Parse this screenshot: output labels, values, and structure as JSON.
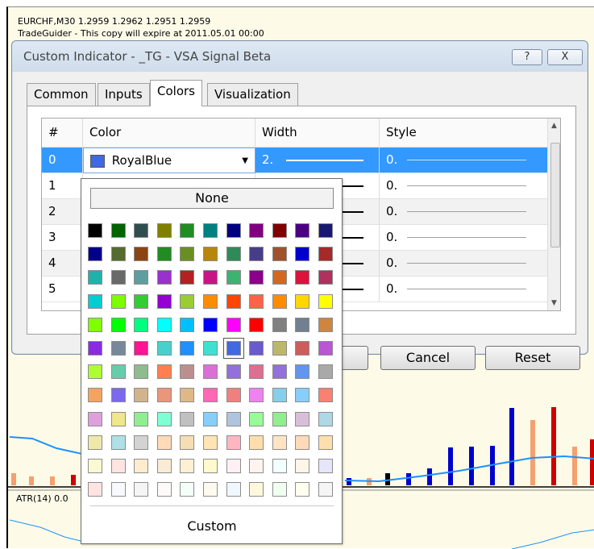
{
  "chart": {
    "header_line1": "EURCHF,M30  1.2959 1.2962 1.2951 1.2959",
    "header_line2": "TradeGuider - This copy will expire at 2011.05.01 00:00",
    "atr_label": "ATR(14) 0.0"
  },
  "dialog": {
    "title": "Custom Indicator - _TG - VSA Signal Beta",
    "help_glyph": "?",
    "close_glyph": "X",
    "tabs": [
      "Common",
      "Inputs",
      "Colors",
      "Visualization"
    ],
    "active_tab": "Colors",
    "cancel_label": "Cancel",
    "reset_label": "Reset"
  },
  "grid": {
    "headers": [
      "#",
      "Color",
      "Width",
      "Style"
    ],
    "rows": [
      {
        "num": "0",
        "color": "RoyalBlue",
        "width": "2.",
        "style": "0."
      },
      {
        "num": "1",
        "color": "",
        "width": "",
        "style": "0."
      },
      {
        "num": "2",
        "color": "",
        "width": "",
        "style": "0."
      },
      {
        "num": "3",
        "color": "",
        "width": "",
        "style": "0."
      },
      {
        "num": "4",
        "color": "",
        "width": "",
        "style": "0."
      },
      {
        "num": "5",
        "color": "",
        "width": "",
        "style": "0."
      }
    ],
    "selected_swatch": "#4169E1"
  },
  "picker": {
    "none_label": "None",
    "custom_label": "Custom",
    "selected_color": "RoyalBlue",
    "colors": [
      [
        "#000000",
        "#006400",
        "#2F4F4F",
        "#808000",
        "#228B22",
        "#008080",
        "#000080",
        "#800080",
        "#800000",
        "#4B0082",
        "#191970"
      ],
      [
        "#00008B",
        "#556B2F",
        "#8B4513",
        "#228B22",
        "#6B8E23",
        "#B8860B",
        "#2E8B57",
        "#483D8B",
        "#A0522D",
        "#0000CD",
        "#A52A2A"
      ],
      [
        "#20B2AA",
        "#696969",
        "#5F9EA0",
        "#9932CC",
        "#B22222",
        "#C71585",
        "#3CB371",
        "#8B008B",
        "#D2691E",
        "#DC143C",
        "#B03060"
      ],
      [
        "#00CED1",
        "#7CFC00",
        "#32CD32",
        "#9400D3",
        "#9ACD32",
        "#FF8C00",
        "#FF4500",
        "#FF6347",
        "#FF8C00",
        "#FFD700",
        "#FFFF00"
      ],
      [
        "#7FFF00",
        "#00FF00",
        "#00FF7F",
        "#00FFFF",
        "#00BFFF",
        "#0000FF",
        "#FF00FF",
        "#FF0000",
        "#808080",
        "#708090",
        "#CD853F"
      ],
      [
        "#8A2BE2",
        "#778899",
        "#FF1493",
        "#48D1CC",
        "#1E90FF",
        "#40E0D0",
        "#4169E1",
        "#6A5ACD",
        "#BDB76B",
        "#CD5C5C",
        "#BA55D3"
      ],
      [
        "#ADFF2F",
        "#66CDAA",
        "#8FBC8F",
        "#FF7F50",
        "#BC8F8F",
        "#DA70D6",
        "#9370DB",
        "#DB7093",
        "#9370DB",
        "#6495ED",
        "#A9A9A9"
      ],
      [
        "#F4A460",
        "#7B68EE",
        "#D2B48C",
        "#E9967A",
        "#DEB887",
        "#FF69B4",
        "#F08080",
        "#EE82EE",
        "#87CEEB",
        "#87CEFA",
        "#FA8072"
      ],
      [
        "#DDA0DD",
        "#F0E68C",
        "#90EE90",
        "#7FFFD4",
        "#C0C0C0",
        "#87CEFA",
        "#B0C4DE",
        "#98FB98",
        "#90EE90",
        "#D8BFD8",
        "#ADD8E6"
      ],
      [
        "#EEE8AA",
        "#B0E0E6",
        "#D3D3D3",
        "#FFDAB9",
        "#F5DEB3",
        "#FFE4B5",
        "#FFB6C1",
        "#FFDEAD",
        "#FFE4C4",
        "#FFDAB9",
        "#FFDEAD"
      ],
      [
        "#FAFAD2",
        "#FFE4E1",
        "#FFEBCD",
        "#FAEBD7",
        "#FFEFD5",
        "#FFFACD",
        "#FFF0F5",
        "#FFF5EE",
        "#F0FFFF",
        "#FDF5E6",
        "#E6E6FA"
      ],
      [
        "#FFE4E1",
        "#F8F8FF",
        "#F5F5F5",
        "#FFFAFA",
        "#F5FFFA",
        "#FFFAF0",
        "#F0F8FF",
        "#FFF8DC",
        "#F0FFF0",
        "#FFFFF0",
        "#F5F5F5"
      ]
    ]
  }
}
